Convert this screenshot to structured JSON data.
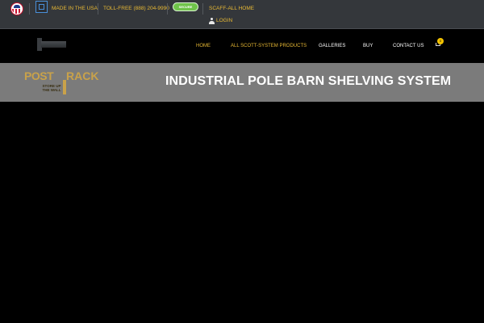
{
  "topbar": {
    "made_in_usa": "MADE IN THE USA",
    "toll_free_label": "TOLL-FREE (888) 204-9990",
    "badge_text": "SECURE",
    "scaff_all_home": "SCAFF-ALL HOME",
    "login": "LOGIN"
  },
  "nav": {
    "items": [
      {
        "label": "HOME"
      },
      {
        "label": "ALL SCOTT-SYSTEM PRODUCTS"
      },
      {
        "label": "GALLERIES"
      },
      {
        "label": "BUY"
      },
      {
        "label": "CONTACT US"
      }
    ],
    "cart_count": "0"
  },
  "banner": {
    "logo_word1": "POST",
    "logo_word2": "RACK",
    "logo_tagline": "STORE UP THE WALL",
    "title": "INDUSTRIAL POLE BARN SHELVING SYSTEM"
  },
  "colors": {
    "accent": "#e8b934",
    "topbar_bg": "#34373b",
    "banner_bg": "#7b7b7b",
    "logo_gold": "#c9a24a"
  },
  "icons": [
    "usa-badge-icon",
    "facebook-icon",
    "user-icon",
    "cart-icon"
  ]
}
